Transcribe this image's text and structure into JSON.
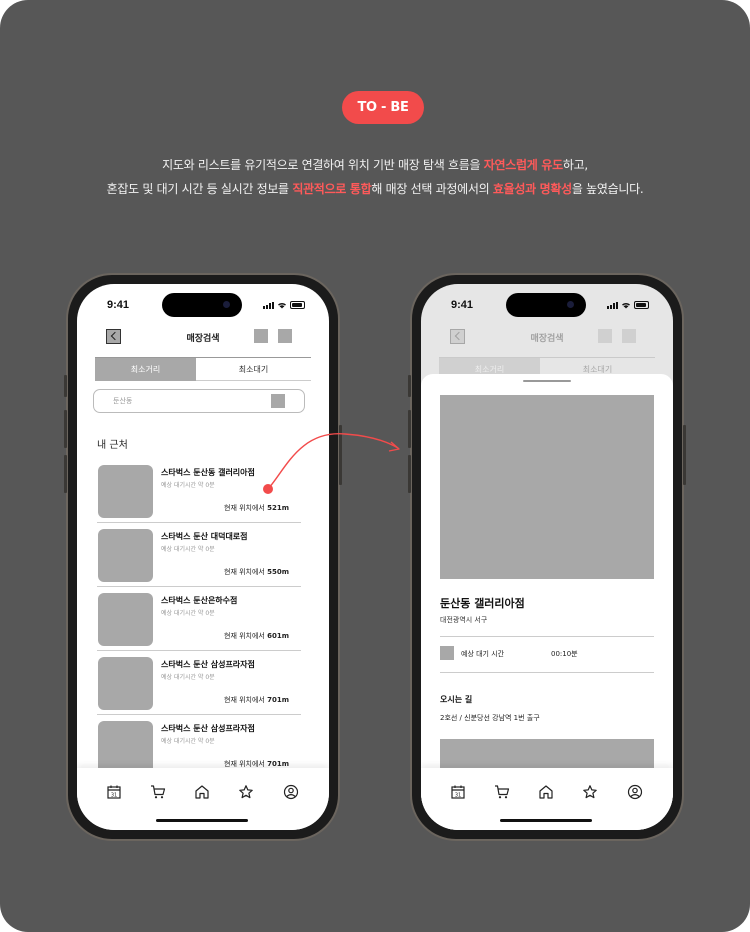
{
  "badge": "TO - BE",
  "headline": {
    "line1": [
      "지도와 리스트를 유기적으로 연결하여 위치 기반 매장 탐색 흐름을 ",
      "자연스럽게 유도",
      "하고,"
    ],
    "line2": [
      "혼잡도 및 대기 시간 등 실시간 정보를 ",
      "직관적으로 통합",
      "해 매장 선택 과정에서의 ",
      "효율성과 명확성",
      "을 높였습니다."
    ]
  },
  "colors": {
    "accent": "#f24b4b",
    "background": "#575757",
    "placeholder": "#a8a8a8"
  },
  "left_phone": {
    "status_time": "9:41",
    "title": "매장검색",
    "tabs": [
      "최소거리",
      "최소대기"
    ],
    "search_placeholder": "둔산동",
    "section_title": "내 근처",
    "stores": [
      {
        "name": "스타벅스 둔산동 갤러리아점",
        "wait": "예상 대기시간  약 0분",
        "dist_prefix": "현재 위치에서 ",
        "dist": "521m"
      },
      {
        "name": "스타벅스 둔산 대덕대로점",
        "wait": "예상 대기시간  약 0분",
        "dist_prefix": "현재 위치에서 ",
        "dist": "550m"
      },
      {
        "name": "스타벅스 둔산은하수점",
        "wait": "예상 대기시간  약 0분",
        "dist_prefix": "현재 위치에서 ",
        "dist": "601m"
      },
      {
        "name": "스타벅스 둔산 삼성프라자점",
        "wait": "예상 대기시간  약 0분",
        "dist_prefix": "현재 위치에서 ",
        "dist": "701m"
      },
      {
        "name": "스타벅스 둔산 삼성프라자점",
        "wait": "예상 대기시간  약 0분",
        "dist_prefix": "현재 위치에서 ",
        "dist": "701m"
      }
    ],
    "tabbar_icons": [
      "calendar-icon",
      "cart-icon",
      "home-icon",
      "star-icon",
      "profile-icon"
    ],
    "calendar_day": "31"
  },
  "right_phone": {
    "status_time": "9:41",
    "title": "매장검색",
    "tabs": [
      "최소거리",
      "최소대기"
    ],
    "store_name": "둔산동 갤러리아점",
    "address": "대전광역시 서구",
    "wait_label": "예상 대기 시간",
    "wait_value": "00:10분",
    "directions_title": "오시는 길",
    "directions": "2호선 / 신분당선 강남역 1번 출구",
    "calendar_day": "31"
  }
}
